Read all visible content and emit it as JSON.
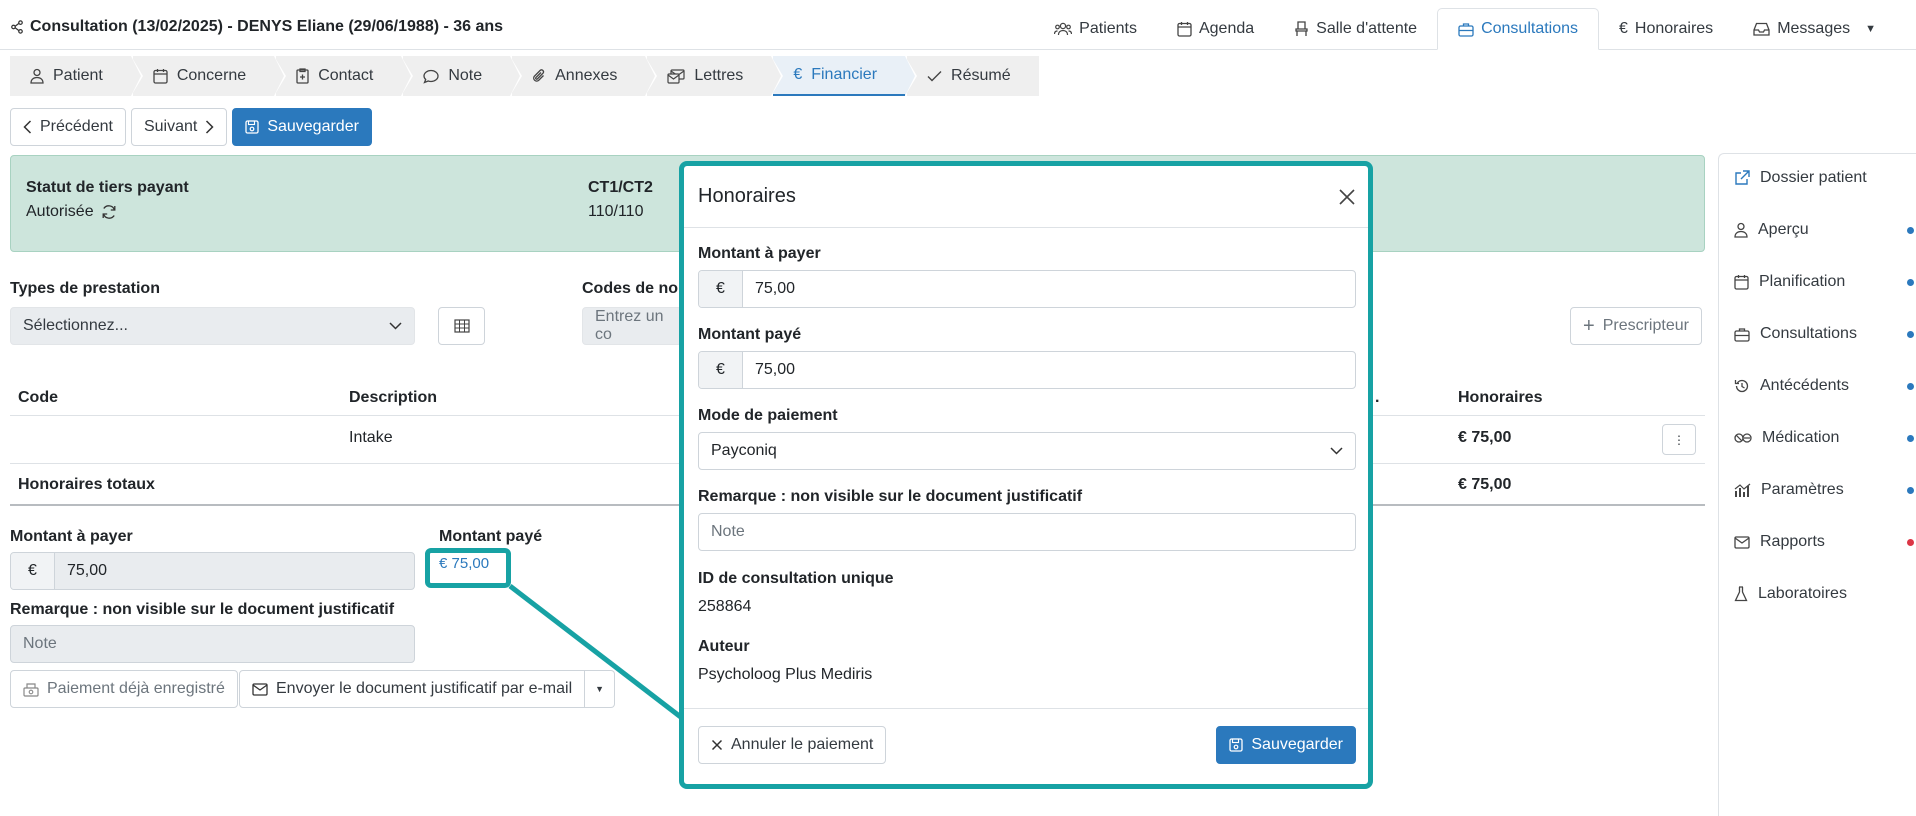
{
  "header": {
    "title": "Consultation (13/02/2025) - DENYS Eliane (29/06/1988) - 36 ans",
    "nav": [
      {
        "label": "Patients",
        "icon": "users-icon"
      },
      {
        "label": "Agenda",
        "icon": "calendar-icon"
      },
      {
        "label": "Salle d'attente",
        "icon": "chair-icon"
      },
      {
        "label": "Consultations",
        "icon": "briefcase-icon",
        "active": true
      },
      {
        "label": "Honoraires",
        "icon": "euro-icon"
      },
      {
        "label": "Messages",
        "icon": "inbox-icon"
      }
    ]
  },
  "steps": [
    {
      "label": "Patient",
      "icon": "person-icon"
    },
    {
      "label": "Concerne",
      "icon": "calendar-icon"
    },
    {
      "label": "Contact",
      "icon": "clipboard-plus-icon"
    },
    {
      "label": "Note",
      "icon": "chat-icon"
    },
    {
      "label": "Annexes",
      "icon": "paperclip-icon"
    },
    {
      "label": "Lettres",
      "icon": "envelopes-icon"
    },
    {
      "label": "Financier",
      "icon": "euro-icon",
      "active": true
    },
    {
      "label": "Résumé",
      "icon": "check-icon"
    }
  ],
  "actions": {
    "previous": "Précédent",
    "next": "Suivant",
    "save": "Sauvegarder"
  },
  "banner": {
    "status_label": "Statut de tiers payant",
    "status_value": "Autorisée",
    "ct_label": "CT1/CT2",
    "ct_value": "110/110"
  },
  "form": {
    "types_label": "Types de prestation",
    "types_value": "Sélectionnez...",
    "codes_label": "Codes de no",
    "codes_placeholder": "Entrez un co",
    "prescriber": "Prescripteur"
  },
  "table": {
    "headers": {
      "code": "Code",
      "description": "Description",
      "dot": ".",
      "honoraires": "Honoraires"
    },
    "row": {
      "code": "",
      "description": "Intake",
      "honoraires": "€ 75,00"
    },
    "total_label": "Honoraires totaux",
    "total_value": "€ 75,00"
  },
  "payment": {
    "amount_due_label": "Montant à payer",
    "currency": "€",
    "amount_due": "75,00",
    "amount_paid_label": "Montant payé",
    "amount_paid": "€ 75,00",
    "remark_label": "Remarque : non visible sur le document justificatif",
    "remark_placeholder": "Note",
    "already_paid": "Paiement déjà enregistré",
    "send_email": "Envoyer le document justificatif par e-mail"
  },
  "sidebar": [
    {
      "label": "Dossier patient",
      "icon": "external-link-icon",
      "dot": ""
    },
    {
      "label": "Aperçu",
      "icon": "person-icon",
      "dot": "#2b79bd"
    },
    {
      "label": "Planification",
      "icon": "calendar-icon",
      "dot": "#2b79bd"
    },
    {
      "label": "Consultations",
      "icon": "briefcase-icon",
      "dot": "#2b79bd"
    },
    {
      "label": "Antécédents",
      "icon": "history-icon",
      "dot": "#2b79bd"
    },
    {
      "label": "Médication",
      "icon": "pills-icon",
      "dot": "#2b79bd"
    },
    {
      "label": "Paramètres",
      "icon": "chart-icon",
      "dot": "#2b79bd"
    },
    {
      "label": "Rapports",
      "icon": "envelope-icon",
      "dot": "#dc3545"
    },
    {
      "label": "Laboratoires",
      "icon": "flask-icon",
      "dot": ""
    }
  ],
  "modal": {
    "title": "Honoraires",
    "amount_due_label": "Montant à payer",
    "currency": "€",
    "amount_due": "75,00",
    "amount_paid_label": "Montant payé",
    "amount_paid": "75,00",
    "mode_label": "Mode de paiement",
    "mode_value": "Payconiq",
    "remark_label": "Remarque : non visible sur le document justificatif",
    "remark_placeholder": "Note",
    "id_label": "ID de consultation unique",
    "id_value": "258864",
    "author_label": "Auteur",
    "author_value": "Psycholoog Plus Mediris",
    "cancel": "Annuler le paiement",
    "save": "Sauvegarder"
  },
  "colors": {
    "primary": "#2b79bd",
    "highlight": "#17a2a4",
    "banner": "#cde5dc"
  }
}
